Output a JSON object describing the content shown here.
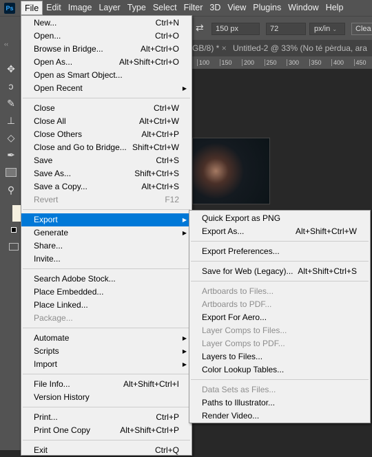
{
  "menubar": {
    "logo": "Ps",
    "items": [
      "File",
      "Edit",
      "Image",
      "Layer",
      "Type",
      "Select",
      "Filter",
      "3D",
      "View",
      "Plugins",
      "Window",
      "Help"
    ]
  },
  "options": {
    "width": "150 px",
    "resolution": "72",
    "unit": "px/in",
    "clear": "Clea"
  },
  "tabs": {
    "tab1": "GB/8) *",
    "tab2": "Untitled-2 @ 33% (No té pèrdua, ara"
  },
  "ruler": [
    "100",
    "150",
    "200",
    "250",
    "300",
    "350",
    "400",
    "450"
  ],
  "file_menu": [
    [
      {
        "label": "New...",
        "shortcut": "Ctrl+N"
      },
      {
        "label": "Open...",
        "shortcut": "Ctrl+O"
      },
      {
        "label": "Browse in Bridge...",
        "shortcut": "Alt+Ctrl+O"
      },
      {
        "label": "Open As...",
        "shortcut": "Alt+Shift+Ctrl+O"
      },
      {
        "label": "Open as Smart Object...",
        "shortcut": ""
      },
      {
        "label": "Open Recent",
        "shortcut": "",
        "submenu": true
      }
    ],
    [
      {
        "label": "Close",
        "shortcut": "Ctrl+W"
      },
      {
        "label": "Close All",
        "shortcut": "Alt+Ctrl+W"
      },
      {
        "label": "Close Others",
        "shortcut": "Alt+Ctrl+P"
      },
      {
        "label": "Close and Go to Bridge...",
        "shortcut": "Shift+Ctrl+W"
      },
      {
        "label": "Save",
        "shortcut": "Ctrl+S"
      },
      {
        "label": "Save As...",
        "shortcut": "Shift+Ctrl+S"
      },
      {
        "label": "Save a Copy...",
        "shortcut": "Alt+Ctrl+S"
      },
      {
        "label": "Revert",
        "shortcut": "F12",
        "disabled": true
      }
    ],
    [
      {
        "label": "Export",
        "shortcut": "",
        "submenu": true,
        "highlighted": true
      },
      {
        "label": "Generate",
        "shortcut": "",
        "submenu": true
      },
      {
        "label": "Share...",
        "shortcut": ""
      },
      {
        "label": "Invite...",
        "shortcut": ""
      }
    ],
    [
      {
        "label": "Search Adobe Stock...",
        "shortcut": ""
      },
      {
        "label": "Place Embedded...",
        "shortcut": ""
      },
      {
        "label": "Place Linked...",
        "shortcut": ""
      },
      {
        "label": "Package...",
        "shortcut": "",
        "disabled": true
      }
    ],
    [
      {
        "label": "Automate",
        "shortcut": "",
        "submenu": true
      },
      {
        "label": "Scripts",
        "shortcut": "",
        "submenu": true
      },
      {
        "label": "Import",
        "shortcut": "",
        "submenu": true
      }
    ],
    [
      {
        "label": "File Info...",
        "shortcut": "Alt+Shift+Ctrl+I"
      },
      {
        "label": "Version History",
        "shortcut": ""
      }
    ],
    [
      {
        "label": "Print...",
        "shortcut": "Ctrl+P"
      },
      {
        "label": "Print One Copy",
        "shortcut": "Alt+Shift+Ctrl+P"
      }
    ],
    [
      {
        "label": "Exit",
        "shortcut": "Ctrl+Q"
      }
    ]
  ],
  "export_menu": [
    [
      {
        "label": "Quick Export as PNG",
        "shortcut": ""
      },
      {
        "label": "Export As...",
        "shortcut": "Alt+Shift+Ctrl+W"
      }
    ],
    [
      {
        "label": "Export Preferences...",
        "shortcut": ""
      }
    ],
    [
      {
        "label": "Save for Web (Legacy)...",
        "shortcut": "Alt+Shift+Ctrl+S"
      }
    ],
    [
      {
        "label": "Artboards to Files...",
        "shortcut": "",
        "disabled": true
      },
      {
        "label": "Artboards to PDF...",
        "shortcut": "",
        "disabled": true
      },
      {
        "label": "Export For Aero...",
        "shortcut": ""
      },
      {
        "label": "Layer Comps to Files...",
        "shortcut": "",
        "disabled": true
      },
      {
        "label": "Layer Comps to PDF...",
        "shortcut": "",
        "disabled": true
      },
      {
        "label": "Layers to Files...",
        "shortcut": ""
      },
      {
        "label": "Color Lookup Tables...",
        "shortcut": ""
      }
    ],
    [
      {
        "label": "Data Sets as Files...",
        "shortcut": "",
        "disabled": true
      },
      {
        "label": "Paths to Illustrator...",
        "shortcut": ""
      },
      {
        "label": "Render Video...",
        "shortcut": ""
      }
    ]
  ],
  "colors": {
    "highlight": "#0078d7",
    "menu_bg": "#f0f0f0",
    "app_bg": "#535353",
    "canvas": "#282828"
  }
}
